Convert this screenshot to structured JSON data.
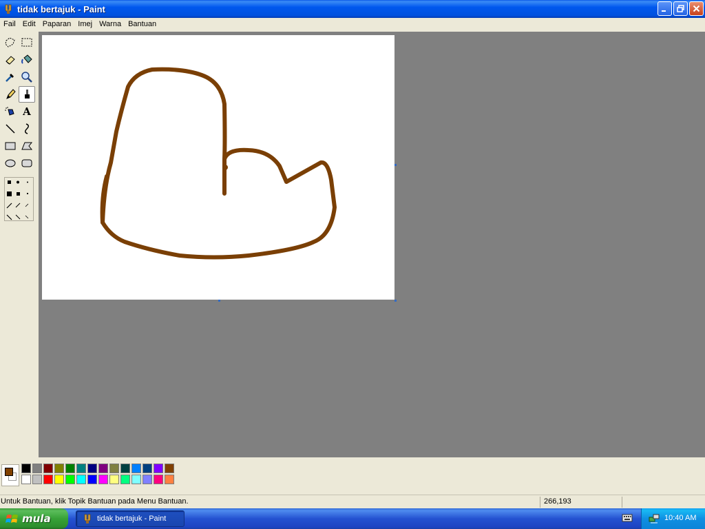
{
  "window": {
    "title": "tidak bertajuk - Paint",
    "controls": [
      "minimize-icon",
      "restore-icon",
      "close-icon"
    ]
  },
  "menu": {
    "items": [
      "Fail",
      "Edit",
      "Paparan",
      "Imej",
      "Warna",
      "Bantuan"
    ]
  },
  "toolbox": {
    "tools": [
      {
        "name": "free-form-select",
        "icon": "free-select-icon"
      },
      {
        "name": "rect-select",
        "icon": "rect-select-icon"
      },
      {
        "name": "eraser",
        "icon": "eraser-icon"
      },
      {
        "name": "fill",
        "icon": "fill-bucket-icon"
      },
      {
        "name": "pick-color",
        "icon": "eyedropper-icon"
      },
      {
        "name": "magnifier",
        "icon": "magnifier-icon"
      },
      {
        "name": "pencil",
        "icon": "pencil-icon"
      },
      {
        "name": "brush",
        "icon": "brush-icon",
        "active": true
      },
      {
        "name": "airbrush",
        "icon": "airbrush-icon"
      },
      {
        "name": "text",
        "icon": "text-icon",
        "glyph": "A"
      },
      {
        "name": "line",
        "icon": "line-icon"
      },
      {
        "name": "curve",
        "icon": "curve-icon"
      },
      {
        "name": "rectangle",
        "icon": "rectangle-icon"
      },
      {
        "name": "polygon",
        "icon": "polygon-icon"
      },
      {
        "name": "ellipse",
        "icon": "ellipse-icon"
      },
      {
        "name": "rounded-rectangle",
        "icon": "rounded-rect-icon"
      }
    ]
  },
  "colors": {
    "foreground": "#804000",
    "background": "#ffffff",
    "stroke": "#7a3f05",
    "palette_top": [
      "#000000",
      "#808080",
      "#800000",
      "#808000",
      "#008000",
      "#008080",
      "#000080",
      "#800080",
      "#808040",
      "#004040",
      "#0080ff",
      "#004080",
      "#8000ff",
      "#804000"
    ],
    "palette_bottom": [
      "#ffffff",
      "#c0c0c0",
      "#ff0000",
      "#ffff00",
      "#00ff00",
      "#00ffff",
      "#0000ff",
      "#ff00ff",
      "#ffff80",
      "#00ff80",
      "#80ffff",
      "#8080ff",
      "#ff0080",
      "#ff8040"
    ]
  },
  "status": {
    "help_text": "Untuk Bantuan, klik Topik Bantuan pada Menu Bantuan.",
    "coordinates": "266,193"
  },
  "taskbar": {
    "start_label": "mula",
    "task_label": "tidak bertajuk - Paint",
    "clock": "10:40 AM"
  }
}
